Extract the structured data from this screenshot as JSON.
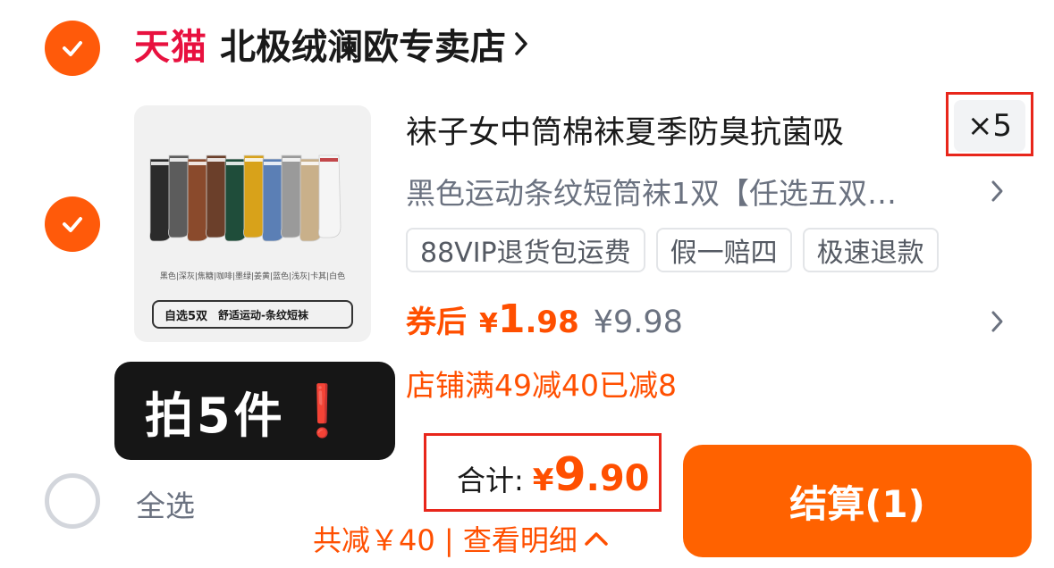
{
  "shop": {
    "logo_text": "天猫",
    "name": "北极绒澜欧专卖店"
  },
  "product": {
    "title": "袜子女中筒棉袜夏季防臭抗菌吸",
    "quantity": "×5",
    "sku": "黑色运动条纹短筒袜1双【任选五双…",
    "tags": [
      "88VIP退货包运费",
      "假一赔四",
      "极速退款"
    ],
    "price_label": "券后",
    "price_currency": "¥",
    "price_integer": "1",
    "price_decimal": ".98",
    "original_price": "¥9.98",
    "promo": "店铺满49减40已减8",
    "image": {
      "colors_caption": "黑色|深灰|焦糖|咖啡|墨绿|姜黄|蓝色|浅灰|卡其|白色",
      "pill_left": "自选5双",
      "pill_right": "舒适运动-条纹短袜",
      "sock_colors": [
        "#2b2b2b",
        "#5c5c5c",
        "#8a4a2c",
        "#6b3f2a",
        "#1f4d3a",
        "#d8a21a",
        "#5b7fb5",
        "#9a9a9a",
        "#c9b08a",
        "#f5f5f5"
      ]
    }
  },
  "overlay": {
    "text": "拍5件",
    "mark": "❗"
  },
  "footer": {
    "select_all": "全选",
    "total_label": "合计:",
    "total_currency": "¥",
    "total_integer": "9",
    "total_decimal": ".90",
    "discount_text": "共减￥40 | 查看明细",
    "checkout_label": "结算(1)"
  },
  "colors": {
    "accent": "#ff5a0a",
    "checkout": "#ff6200",
    "tmall_red": "#e8113f",
    "highlight_box": "#e8261b"
  }
}
